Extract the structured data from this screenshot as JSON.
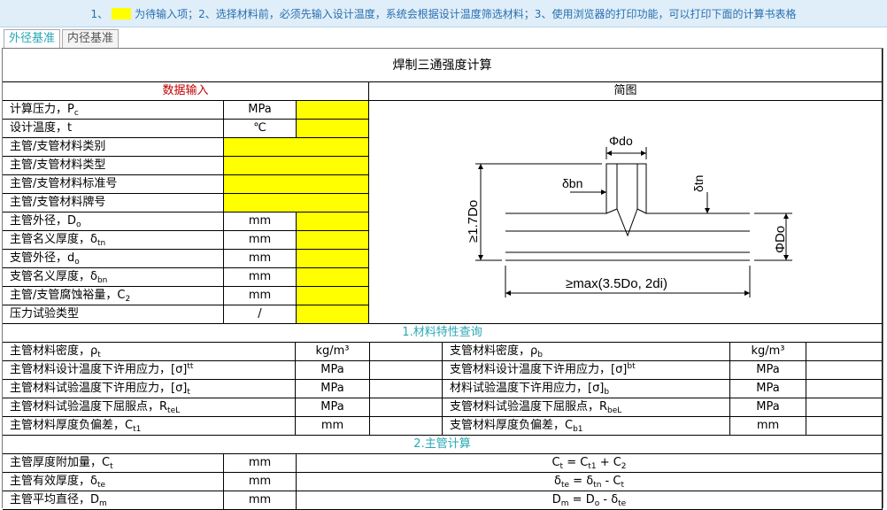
{
  "notice": {
    "prefix": "1、",
    "text": "为待输入项；2、选择材料前，必须先输入设计温度，系统会根据设计温度筛选材料；3、使用浏览器的打印功能，可以打印下面的计算书表格"
  },
  "tabs": [
    {
      "label": "外径基准",
      "active": true
    },
    {
      "label": "内径基准",
      "active": false
    }
  ],
  "colors": {
    "input": "#ffff00",
    "section_header": "#2aa7b5",
    "data_input_header": "#c00000"
  },
  "sheet": {
    "title": "焊制三通强度计算",
    "data_input_header": "数据输入",
    "diagram_header": "简图"
  },
  "inputs": [
    {
      "label": "计算压力，P",
      "sub": "c",
      "unit": "MPa",
      "value": ""
    },
    {
      "label": "设计温度，t",
      "sub": "",
      "unit": "℃",
      "value": ""
    },
    {
      "label": "主管/支管材料类别",
      "sub": "",
      "unit": "",
      "value": ""
    },
    {
      "label": "主管/支管材料类型",
      "sub": "",
      "unit": "",
      "value": ""
    },
    {
      "label": "主管/支管材料标准号",
      "sub": "",
      "unit": "",
      "value": ""
    },
    {
      "label": "主管/支管材料牌号",
      "sub": "",
      "unit": "",
      "value": ""
    },
    {
      "label": "主管外径，D",
      "sub": "o",
      "unit": "mm",
      "value": ""
    },
    {
      "label": "主管名义厚度，δ",
      "sub": "tn",
      "unit": "mm",
      "value": ""
    },
    {
      "label": "支管外径，d",
      "sub": "o",
      "unit": "mm",
      "value": ""
    },
    {
      "label": "支管名义厚度，δ",
      "sub": "bn",
      "unit": "mm",
      "value": ""
    },
    {
      "label": "主管/支管腐蚀裕量，C",
      "sub": "2",
      "unit": "mm",
      "value": ""
    },
    {
      "label": "压力试验类型",
      "sub": "",
      "unit": "/",
      "value": ""
    }
  ],
  "diagram": {
    "phi_do": "Φdo",
    "delta_bn": "δbn",
    "delta_tn": "δtn",
    "phi_Do": "ΦDo",
    "height": "≥1.7Do",
    "length": "≥max(3.5Do, 2di)"
  },
  "section1": {
    "title": "1.材料特性查询",
    "rows": [
      {
        "left": {
          "label": "主管材料密度，ρ",
          "sub": "t",
          "sup": "",
          "unit": "kg/m³",
          "value": ""
        },
        "right": {
          "label": "支管材料密度，ρ",
          "sub": "b",
          "sup": "",
          "unit": "kg/m³",
          "value": ""
        }
      },
      {
        "left": {
          "label": "主管材料设计温度下许用应力，[σ]",
          "sub": "",
          "sup": "tt",
          "unit": "MPa",
          "value": ""
        },
        "right": {
          "label": "支管材料设计温度下许用应力，[σ]",
          "sub": "",
          "sup": "bt",
          "unit": "MPa",
          "value": ""
        }
      },
      {
        "left": {
          "label": "主管材料试验温度下许用应力，[σ]",
          "sub": "t",
          "sup": "",
          "unit": "MPa",
          "value": ""
        },
        "right": {
          "label": "材料试验温度下许用应力，[σ]",
          "sub": "b",
          "sup": "",
          "unit": "MPa",
          "value": ""
        }
      },
      {
        "left": {
          "label": "主管材料试验温度下屈服点，R",
          "sub": "teL",
          "sup": "",
          "unit": "MPa",
          "value": ""
        },
        "right": {
          "label": "支管材料试验温度下屈服点，R",
          "sub": "beL",
          "sup": "",
          "unit": "MPa",
          "value": ""
        }
      },
      {
        "left": {
          "label": "主管材料厚度负偏差，C",
          "sub": "t1",
          "sup": "",
          "unit": "mm",
          "value": ""
        },
        "right": {
          "label": "支管材料厚度负偏差，C",
          "sub": "b1",
          "sup": "",
          "unit": "mm",
          "value": ""
        }
      }
    ]
  },
  "section2": {
    "title": "2.主管计算",
    "rows": [
      {
        "label": "主管厚度附加量，C",
        "sub": "t",
        "unit": "mm",
        "formula": [
          {
            "t": "C"
          },
          {
            "s": "t"
          },
          {
            "t": " = C"
          },
          {
            "s": "t1"
          },
          {
            "t": " + C"
          },
          {
            "s": "2"
          }
        ]
      },
      {
        "label": "主管有效厚度，δ",
        "sub": "te",
        "unit": "mm",
        "formula": [
          {
            "t": "δ"
          },
          {
            "s": "te"
          },
          {
            "t": " = δ"
          },
          {
            "s": "tn"
          },
          {
            "t": " - C"
          },
          {
            "s": "t"
          }
        ]
      },
      {
        "label": "主管平均直径，D",
        "sub": "m",
        "unit": "mm",
        "formula": [
          {
            "t": "D"
          },
          {
            "s": "m"
          },
          {
            "t": " = D"
          },
          {
            "s": "o"
          },
          {
            "t": " - δ"
          },
          {
            "s": "te"
          }
        ]
      }
    ]
  }
}
